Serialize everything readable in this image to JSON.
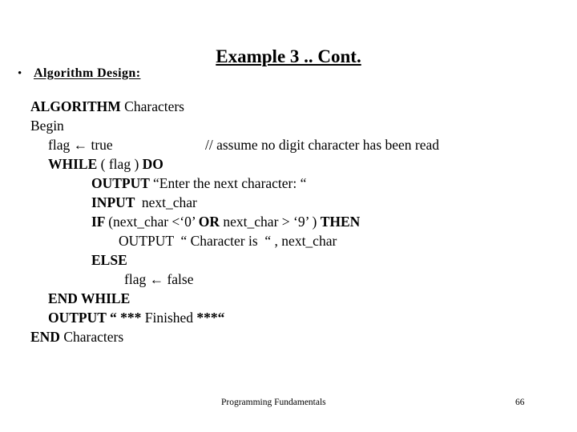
{
  "slide": {
    "title": "Example 3 .. Cont.",
    "bullet": {
      "marker": "•",
      "label": "Algorithm Design:"
    },
    "code_lines": [
      {
        "indent": 0,
        "parts": [
          {
            "text": "ALGORITHM ",
            "bold": true
          },
          {
            "text": "Characters",
            "bold": false
          }
        ]
      },
      {
        "indent": 0,
        "parts": [
          {
            "text": "Begin",
            "bold": false
          }
        ]
      },
      {
        "indent": 1,
        "parts": [
          {
            "text": "flag ← true",
            "bold": false
          }
        ],
        "comment": "// assume no digit character has been read"
      },
      {
        "indent": 1,
        "parts": [
          {
            "text": "WHILE ",
            "bold": true
          },
          {
            "text": "( flag )",
            "bold": false
          },
          {
            "text": " DO",
            "bold": true
          }
        ]
      },
      {
        "indent": 2,
        "parts": [
          {
            "text": "OUTPUT ",
            "bold": true
          },
          {
            "text": "“Enter the next character: “",
            "bold": false
          }
        ]
      },
      {
        "indent": 2,
        "parts": [
          {
            "text": "INPUT ",
            "bold": true
          },
          {
            "text": " next_char",
            "bold": false
          }
        ]
      },
      {
        "indent": 2,
        "parts": [
          {
            "text": "IF ",
            "bold": true
          },
          {
            "text": "(next_char <‘0’ ",
            "bold": false
          },
          {
            "text": "OR",
            "bold": true
          },
          {
            "text": " next_char > ‘9’ ) ",
            "bold": false
          },
          {
            "text": "THEN",
            "bold": true
          }
        ]
      },
      {
        "indent": 3,
        "parts": [
          {
            "text": "OUTPUT  “ Character is  “ , next_char",
            "bold": false
          }
        ]
      },
      {
        "indent": 2,
        "parts": [
          {
            "text": "ELSE",
            "bold": true
          }
        ]
      },
      {
        "indent": 4,
        "parts": [
          {
            "text": "flag ← false",
            "bold": false
          }
        ]
      },
      {
        "indent": 1,
        "parts": [
          {
            "text": "END WHILE",
            "bold": true
          }
        ]
      },
      {
        "indent": 1,
        "parts": [
          {
            "text": "OUTPUT “ *** ",
            "bold": true
          },
          {
            "text": "Finished",
            "bold": false
          },
          {
            "text": " ***“",
            "bold": true
          }
        ]
      },
      {
        "indent": 0,
        "parts": [
          {
            "text": "END ",
            "bold": true
          },
          {
            "text": "Characters",
            "bold": false
          }
        ]
      }
    ]
  },
  "footer": {
    "course": "Programming Fundamentals",
    "page_number": "66"
  },
  "colors": {
    "background": "#ffffff",
    "text": "#000000"
  }
}
